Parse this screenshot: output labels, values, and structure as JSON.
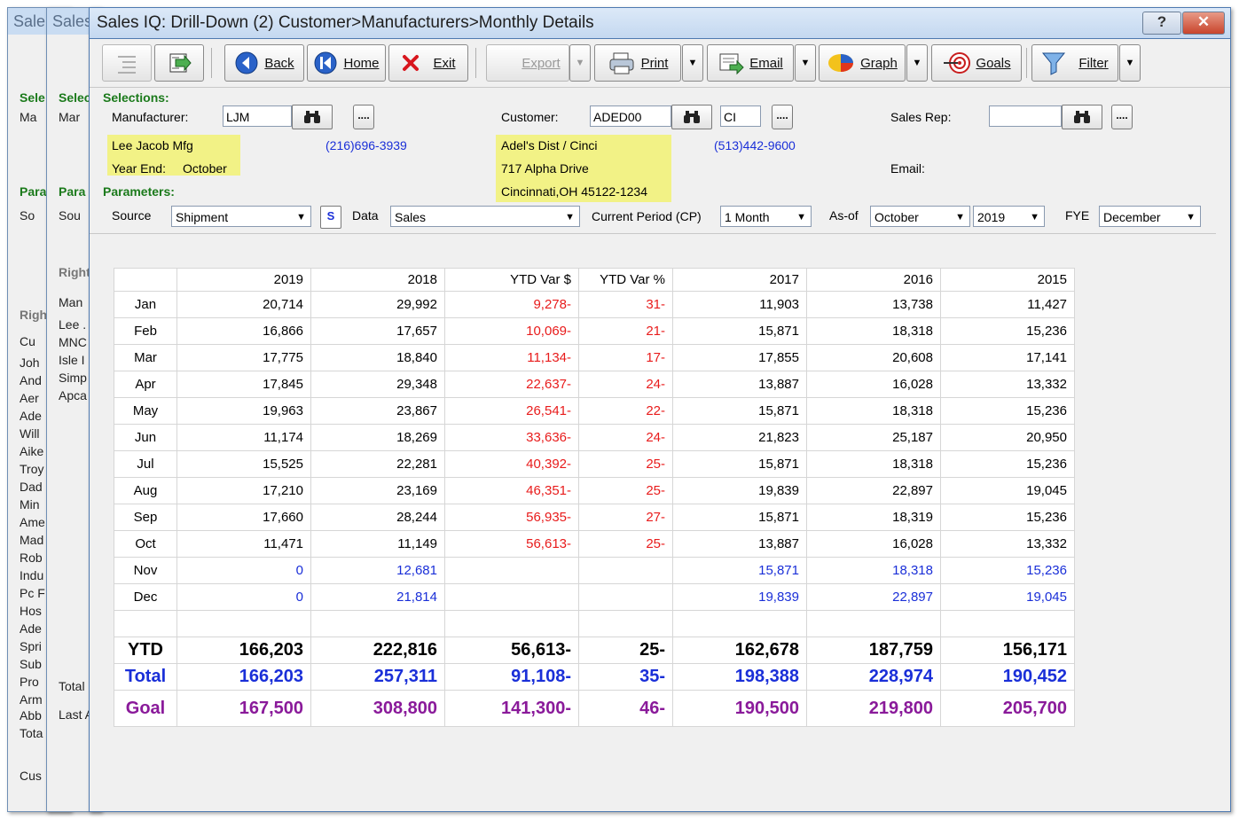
{
  "background_windows": {
    "win1": {
      "title": "Sale",
      "texts": [
        "Sele",
        "Ma",
        "Para",
        "So",
        "Righ",
        "Cu",
        "Joh",
        "And",
        "Aer",
        "Ade",
        "Will",
        "Aike",
        "Troy",
        "Dad",
        "Min",
        "Ame",
        "Mad",
        "Rob",
        "Indu",
        "Pc F",
        "Hos",
        "Ade",
        "Spri",
        "Sub",
        "Pro",
        "Arm",
        "Abb",
        "Tota",
        "Cus"
      ]
    },
    "win2": {
      "title": "Sales",
      "texts": [
        "Selec",
        "Mar",
        "Para",
        "Sou",
        "Right",
        "Man",
        "Lee .",
        "MNC",
        "Isle I",
        "Simp",
        "Apca",
        "Total",
        "Last A"
      ]
    }
  },
  "window": {
    "title": "Sales IQ: Drill-Down (2) Customer>Manufacturers>Monthly Details",
    "help": "?",
    "close": "✕"
  },
  "toolbar": {
    "back": "Back",
    "home": "Home",
    "exit": "Exit",
    "export": "Export",
    "print": "Print",
    "email": "Email",
    "graph": "Graph",
    "goals": "Goals",
    "filter": "Filter"
  },
  "selections": {
    "heading": "Selections:",
    "manufacturer_label": "Manufacturer:",
    "manufacturer_value": "LJM",
    "manufacturer_name": "Lee Jacob Mfg",
    "year_end_label": "Year End:",
    "year_end_value": "October",
    "manufacturer_phone": "(216)696-3939",
    "customer_label": "Customer:",
    "customer_value": "ADED00",
    "customer_sub": "CI",
    "customer_name": "Adel's Dist / Cinci",
    "customer_addr1": "717 Alpha Drive",
    "customer_addr2": "Cincinnati,OH 45122-1234",
    "customer_phone": "(513)442-9600",
    "salesrep_label": "Sales Rep:",
    "salesrep_value": "",
    "email_label": "Email:",
    "ellipsis": "...."
  },
  "parameters": {
    "heading": "Parameters:",
    "source_label": "Source",
    "source_value": "Shipment",
    "s_button": "S",
    "data_label": "Data",
    "data_value": "Sales",
    "period_label": "Current Period (CP)",
    "period_value": "1 Month",
    "asof_label": "As-of",
    "asof_month": "October",
    "asof_year": "2019",
    "fye_label": "FYE",
    "fye_value": "December"
  },
  "table": {
    "headers": [
      "",
      "2019",
      "2018",
      "YTD Var $",
      "YTD Var %",
      "2017",
      "2016",
      "2015"
    ],
    "rows": [
      [
        "Jan",
        "20,714",
        "29,992",
        "9,278-",
        "31-",
        "11,903",
        "13,738",
        "11,427"
      ],
      [
        "Feb",
        "16,866",
        "17,657",
        "10,069-",
        "21-",
        "15,871",
        "18,318",
        "15,236"
      ],
      [
        "Mar",
        "17,775",
        "18,840",
        "11,134-",
        "17-",
        "17,855",
        "20,608",
        "17,141"
      ],
      [
        "Apr",
        "17,845",
        "29,348",
        "22,637-",
        "24-",
        "13,887",
        "16,028",
        "13,332"
      ],
      [
        "May",
        "19,963",
        "23,867",
        "26,541-",
        "22-",
        "15,871",
        "18,318",
        "15,236"
      ],
      [
        "Jun",
        "11,174",
        "18,269",
        "33,636-",
        "24-",
        "21,823",
        "25,187",
        "20,950"
      ],
      [
        "Jul",
        "15,525",
        "22,281",
        "40,392-",
        "25-",
        "15,871",
        "18,318",
        "15,236"
      ],
      [
        "Aug",
        "17,210",
        "23,169",
        "46,351-",
        "25-",
        "19,839",
        "22,897",
        "19,045"
      ],
      [
        "Sep",
        "17,660",
        "28,244",
        "56,935-",
        "27-",
        "15,871",
        "18,319",
        "15,236"
      ],
      [
        "Oct",
        "11,471",
        "11,149",
        "56,613-",
        "25-",
        "13,887",
        "16,028",
        "13,332"
      ],
      [
        "Nov",
        "0",
        "12,681",
        "",
        "",
        "15,871",
        "18,318",
        "15,236"
      ],
      [
        "Dec",
        "0",
        "21,814",
        "",
        "",
        "19,839",
        "22,897",
        "19,045"
      ],
      [
        "",
        "",
        "",
        "",
        "",
        "",
        "",
        ""
      ]
    ],
    "ytd": [
      "YTD",
      "166,203",
      "222,816",
      "56,613-",
      "25-",
      "162,678",
      "187,759",
      "156,171"
    ],
    "total": [
      "Total",
      "166,203",
      "257,311",
      "91,108-",
      "35-",
      "198,388",
      "228,974",
      "190,452"
    ],
    "goal": [
      "Goal",
      "167,500",
      "308,800",
      "141,300-",
      "46-",
      "190,500",
      "219,800",
      "205,700"
    ]
  },
  "colors": {
    "negative": "#e81b1b",
    "future": "#1a2fd8",
    "goal": "#8a1a9a",
    "highlight": "#f2f286",
    "section_heading": "#1b7a1b"
  }
}
